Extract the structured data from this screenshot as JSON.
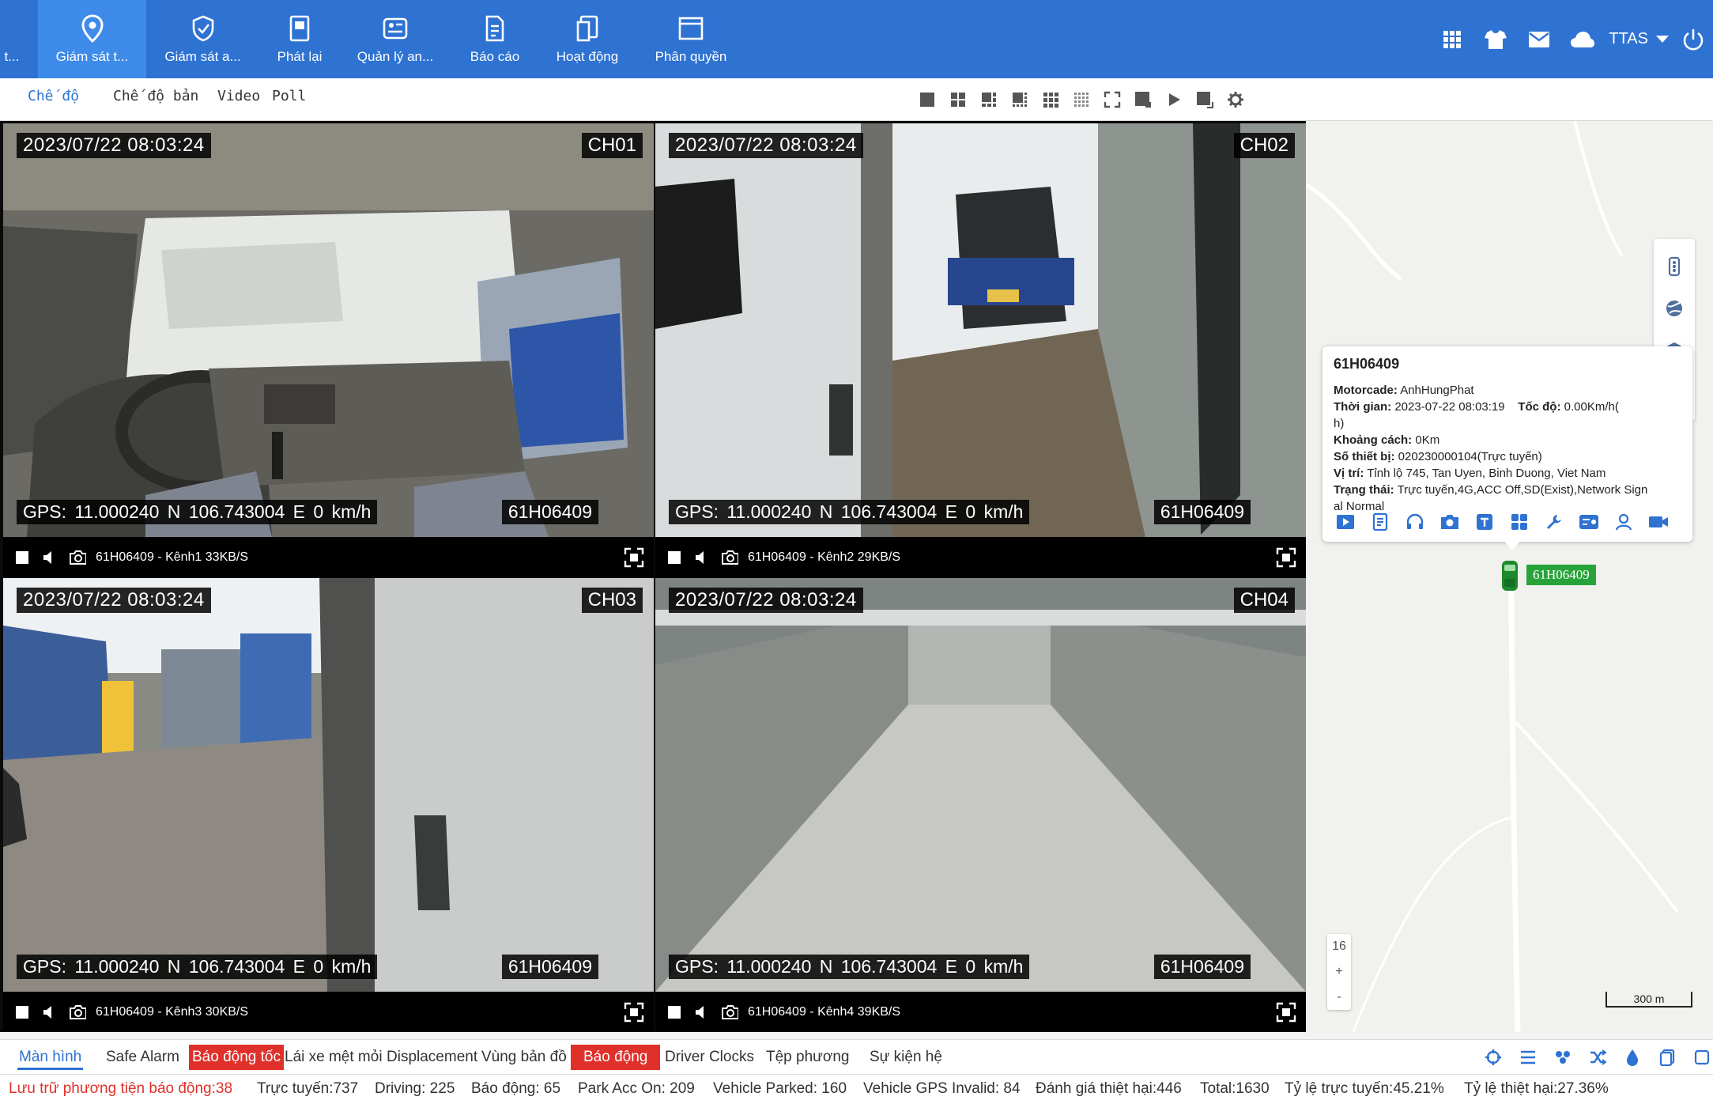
{
  "nav": {
    "items": [
      {
        "label": "t...",
        "icon": "truncated-icon"
      },
      {
        "label": "Giám sát t...",
        "icon": "location-pin-icon"
      },
      {
        "label": "Giám sát a...",
        "icon": "shield-check-icon"
      },
      {
        "label": "Phát lại",
        "icon": "playback-icon"
      },
      {
        "label": "Quản lý an...",
        "icon": "safety-manage-icon"
      },
      {
        "label": "Báo cáo",
        "icon": "report-icon"
      },
      {
        "label": "Hoạt động",
        "icon": "activity-icon"
      },
      {
        "label": "Phân quyền",
        "icon": "permission-icon"
      }
    ],
    "user": "TTAS"
  },
  "modebar": {
    "mode_label": "Chế độ",
    "map_video_label": "Chế độ bản",
    "video_label": "Video",
    "poll_label": "Poll"
  },
  "cameras": [
    {
      "time": "2023/07/22  08:03:24",
      "channel": "CH01",
      "gps": "GPS: 11.000240 N  106.743004 E   0 km/h",
      "plate": "61H06409",
      "label": "61H06409 - Kênh1 33KB/S"
    },
    {
      "time": "2023/07/22  08:03:24",
      "channel": "CH02",
      "gps": "GPS: 11.000240 N  106.743004 E   0 km/h",
      "plate": "61H06409",
      "label": "61H06409 - Kênh2 29KB/S"
    },
    {
      "time": "2023/07/22  08:03:24",
      "channel": "CH03",
      "gps": "GPS: 11.000240 N  106.743004 E   0 km/h",
      "plate": "61H06409",
      "label": "61H06409 - Kênh3 30KB/S"
    },
    {
      "time": "2023/07/22  08:03:24",
      "channel": "CH04",
      "gps": "GPS: 11.000240 N  106.743004 E   0 km/h",
      "plate": "61H06409",
      "label": "61H06409 - Kênh4 39KB/S"
    }
  ],
  "popup": {
    "title": "61H06409",
    "motorcade_label": "Motorcade:",
    "motorcade": "AnhHungPhat",
    "time_label": "Thời gian:",
    "time": "2023-07-22 08:03:19",
    "speed_label": "Tốc độ:",
    "speed": "0.00Km/h(",
    "speed_cont": "h)",
    "distance_label": "Khoảng cách:",
    "distance": "0Km",
    "device_label": "Số thiết bị:",
    "device": "020230000104(Trực tuyến)",
    "location_label": "Vị trí:",
    "location": "Tỉnh lộ 745, Tan Uyen, Binh Duong, Viet Nam",
    "status_label": "Trạng thái:",
    "status": "Trực tuyến,4G,ACC Off,SD(Exist),Network Sign",
    "status_cont": "al Normal"
  },
  "map": {
    "vehicle_label": "61H06409",
    "zoom_level": "16",
    "zoom_in": "+",
    "zoom_out": "-",
    "scale": "300 m"
  },
  "tabs": [
    {
      "label": "Màn hình",
      "state": "active"
    },
    {
      "label": "Safe Alarm",
      "state": "normal"
    },
    {
      "label": "Báo động tốc",
      "state": "red"
    },
    {
      "label": "Lái xe mệt mỏi",
      "state": "normal"
    },
    {
      "label": "Displacement",
      "state": "normal"
    },
    {
      "label": "Vùng bản đồ",
      "state": "normal"
    },
    {
      "label": "Báo động",
      "state": "red"
    },
    {
      "label": "Driver Clocks",
      "state": "normal"
    },
    {
      "label": "Tệp phương",
      "state": "normal"
    },
    {
      "label": "Sự kiện hệ",
      "state": "normal"
    }
  ],
  "status": {
    "alarm_storage": "Lưu trữ phương tiện báo động:38",
    "online": "Trực tuyến:737",
    "driving": "Driving: 225",
    "alarm": "Báo động: 65",
    "park_acc_on": "Park Acc On: 209",
    "parked": "Vehicle Parked: 160",
    "gps_invalid": "Vehicle GPS Invalid: 84",
    "damage_eval": "Đánh giá thiệt hại:446",
    "total": "Total:1630",
    "online_rate": "Tỷ lệ trực tuyến:45.21%",
    "damage_rate": "Tỷ lệ thiệt hại:27.36%"
  },
  "colors": {
    "nav_bg": "#2e72d2",
    "nav_active": "#3f8bea",
    "alarm_red": "#e0302a",
    "vehicle_green": "#27a33a"
  }
}
